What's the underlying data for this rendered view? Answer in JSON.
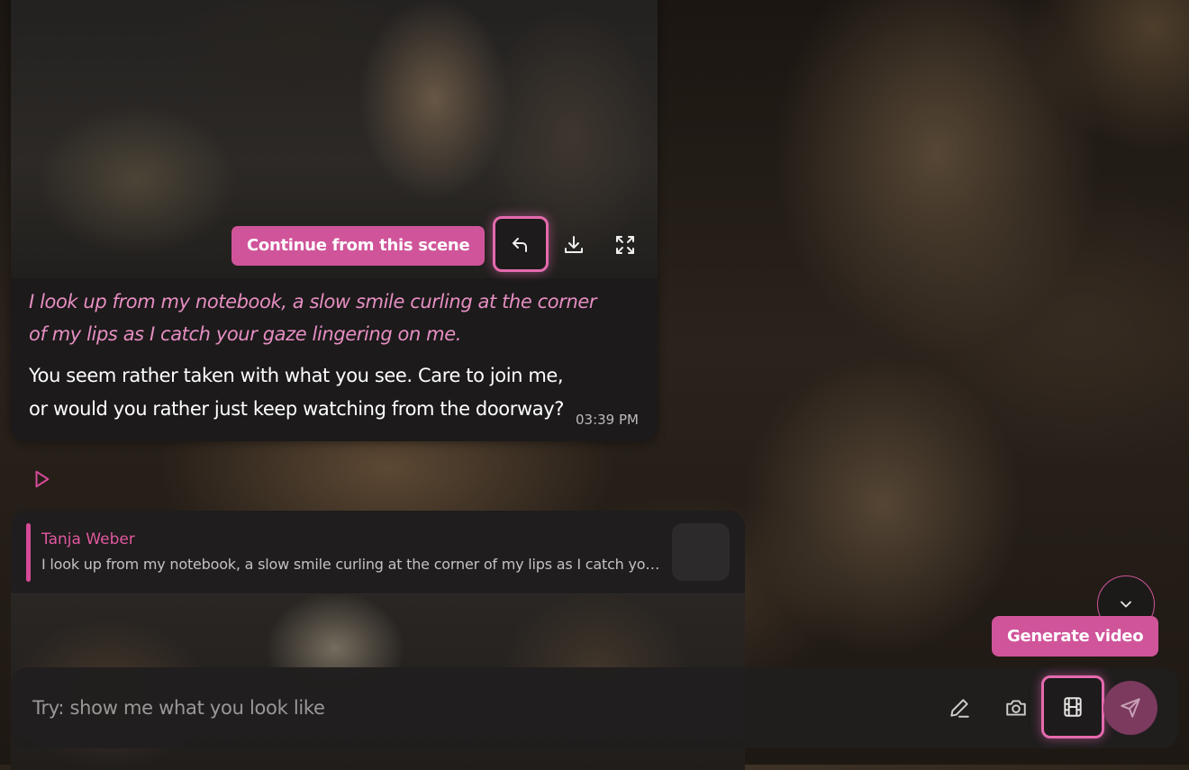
{
  "message": {
    "continue_label": "Continue from this scene",
    "italic_text": "I look up from my notebook, a slow smile curling at the corner of my lips as I catch your gaze lingering on me.",
    "text": "You seem rather taken with what you see. Care to join me, or would you rather just keep watching from the doorway?",
    "time": "03:39 PM"
  },
  "reply_quote": {
    "name": "Tanja Weber",
    "text": "I look up from my notebook, a slow smile curling at the corner of my lips as I catch your gaze lingering on me."
  },
  "tooltip": {
    "generate_video": "Generate video"
  },
  "composer": {
    "placeholder": "Try: show me what you look like"
  },
  "icons": {
    "reply": "reply-icon",
    "download": "download-icon",
    "fullscreen": "fullscreen-icon",
    "play": "play-icon",
    "chevron": "chevron-down-icon",
    "edit": "pencil-icon",
    "camera": "camera-icon",
    "video": "film-icon",
    "send": "send-icon"
  },
  "colors": {
    "accent": "#d0549a",
    "italic": "#e68ec2"
  }
}
